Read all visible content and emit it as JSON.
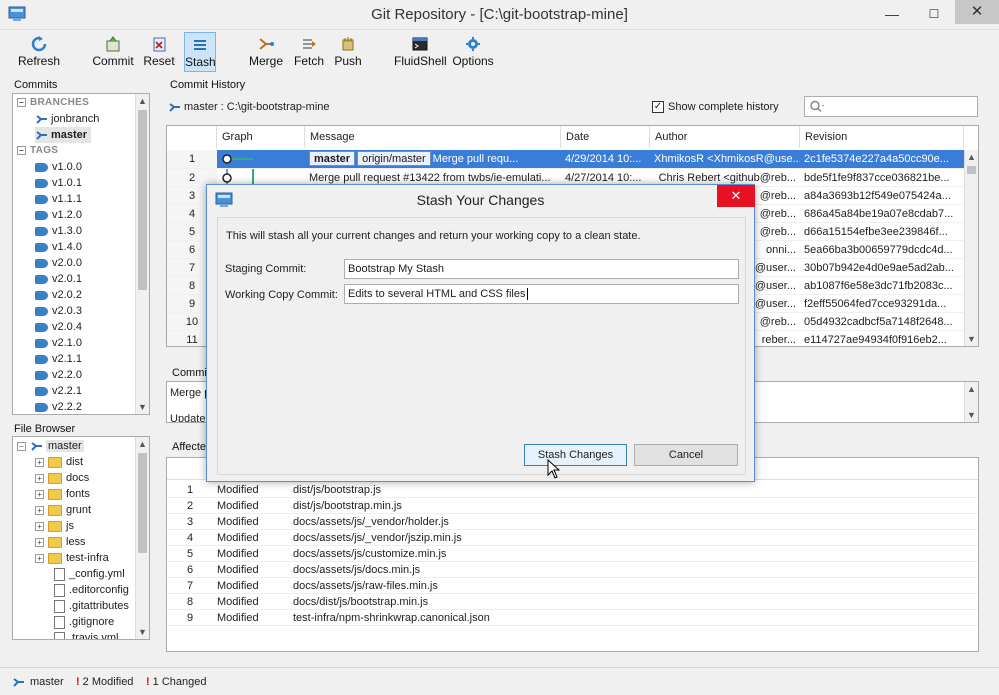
{
  "window": {
    "title": "Git Repository - [C:\\git-bootstrap-mine]",
    "minimize": "—",
    "maximize": "☐",
    "close": "✕"
  },
  "toolbar": {
    "refresh": "Refresh",
    "commit": "Commit",
    "reset": "Reset",
    "stash": "Stash",
    "merge": "Merge",
    "fetch": "Fetch",
    "push": "Push",
    "fluidshell": "FluidShell",
    "options": "Options"
  },
  "commits_panel": {
    "label": "Commits",
    "branches_header": "BRANCHES",
    "branches": [
      "jonbranch",
      "master"
    ],
    "tags_header": "TAGS",
    "tags": [
      "v1.0.0",
      "v1.0.1",
      "v1.1.1",
      "v1.2.0",
      "v1.3.0",
      "v1.4.0",
      "v2.0.0",
      "v2.0.1",
      "v2.0.2",
      "v2.0.3",
      "v2.0.4",
      "v2.1.0",
      "v2.1.1",
      "v2.2.0",
      "v2.2.1",
      "v2.2.2"
    ]
  },
  "file_browser": {
    "label": "File Browser",
    "root": "master",
    "folders": [
      "dist",
      "docs",
      "fonts",
      "grunt",
      "js",
      "less",
      "test-infra"
    ],
    "files": [
      "_config.yml",
      ".editorconfig",
      ".gitattributes",
      ".gitignore",
      ".travis.yml"
    ]
  },
  "commit_history": {
    "label": "Commit History",
    "branch_path": "master : C:\\git-bootstrap-mine",
    "show_complete_label": "Show complete history",
    "search_icon": "search-icon",
    "columns": [
      "Graph",
      "Message",
      "Date",
      "Author",
      "Revision"
    ],
    "first_row": {
      "num": "1",
      "badge_master": "master",
      "badge_origin": "origin/master",
      "message": "Merge pull requ...",
      "date": "4/29/2014 10:...",
      "author": "XhmikosR <XhmikosR@use...",
      "revision": "2c1fe5374e227a4a50cc90e..."
    },
    "rows": [
      {
        "num": "2",
        "message": "Merge pull request #13422 from twbs/ie-emulati...",
        "date": "4/27/2014 10:...",
        "author": "Chris Rebert <github@reb...",
        "revision": "bde5f1fe9f837cce036821be..."
      },
      {
        "num": "3",
        "message": "",
        "date": "",
        "author": "@reb...",
        "revision": "a84a3693b12f549e075424a..."
      },
      {
        "num": "4",
        "message": "",
        "date": "",
        "author": "@reb...",
        "revision": "686a45a84be19a07e8cdab7..."
      },
      {
        "num": "5",
        "message": "",
        "date": "",
        "author": "@reb...",
        "revision": "d66a15154efbe3ee239846f..."
      },
      {
        "num": "6",
        "message": "",
        "date": "",
        "author": "onni...",
        "revision": "5ea66ba3b00659779dcdc4d..."
      },
      {
        "num": "7",
        "message": "",
        "date": "",
        "author": "@user...",
        "revision": "30b07b942e4d0e9ae5ad2ab..."
      },
      {
        "num": "8",
        "message": "",
        "date": "",
        "author": "@user...",
        "revision": "ab1087f6e58e3dc71fb2083c..."
      },
      {
        "num": "9",
        "message": "",
        "date": "",
        "author": "@user...",
        "revision": "f2eff55064fed7cce93291da..."
      },
      {
        "num": "10",
        "message": "",
        "date": "",
        "author": "@reb...",
        "revision": "05d4932cadbcf5a7148f2648..."
      },
      {
        "num": "11",
        "message": "",
        "date": "",
        "author": "reber...",
        "revision": "e114727ae94934f0f916eb2..."
      }
    ]
  },
  "commit_details": {
    "label": "Commit",
    "line1": "Merge p",
    "line2": "Update"
  },
  "affected_files": {
    "label": "Affecte",
    "rows": [
      {
        "num": "1",
        "status": "Modified",
        "path": "dist/js/bootstrap.js"
      },
      {
        "num": "2",
        "status": "Modified",
        "path": "dist/js/bootstrap.min.js"
      },
      {
        "num": "3",
        "status": "Modified",
        "path": "docs/assets/js/_vendor/holder.js"
      },
      {
        "num": "4",
        "status": "Modified",
        "path": "docs/assets/js/_vendor/jszip.min.js"
      },
      {
        "num": "5",
        "status": "Modified",
        "path": "docs/assets/js/customize.min.js"
      },
      {
        "num": "6",
        "status": "Modified",
        "path": "docs/assets/js/docs.min.js"
      },
      {
        "num": "7",
        "status": "Modified",
        "path": "docs/assets/js/raw-files.min.js"
      },
      {
        "num": "8",
        "status": "Modified",
        "path": "docs/dist/js/bootstrap.min.js"
      },
      {
        "num": "9",
        "status": "Modified",
        "path": "test-infra/npm-shrinkwrap.canonical.json"
      }
    ]
  },
  "stash_dialog": {
    "title": "Stash Your Changes",
    "close": "✕",
    "description": "This will stash all your current changes and return your working copy to a clean state.",
    "staging_label": "Staging Commit:",
    "staging_value": "Bootstrap My Stash",
    "working_label": "Working Copy Commit:",
    "working_value": "Edits to several HTML and CSS files",
    "stash_button": "Stash Changes",
    "cancel_button": "Cancel"
  },
  "status_bar": {
    "branch": "master",
    "modified": "2 Modified",
    "changed": "1 Changed"
  }
}
